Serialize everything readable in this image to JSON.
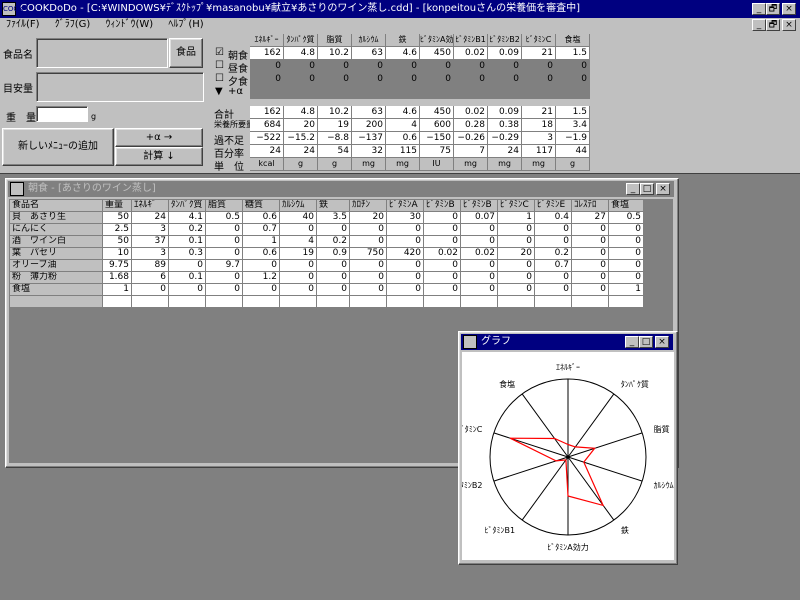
{
  "app": {
    "title": "COOKDoDo - [C:¥WINDOWS¥ﾃﾞｽｸﾄｯﾌﾟ¥masanobu¥献立¥あさりのワイン蒸し.cdd] - [konpeitouさんの栄養価を審査中]",
    "icon": "COOK",
    "controls": [
      "_",
      "🗗",
      "×"
    ]
  },
  "menu": [
    "ﾌｧｲﾙ(F)",
    "ｸﾞﾗﾌ(G)",
    "ｳｨﾝﾄﾞｳ(W)",
    "ﾍﾙﾌﾟ(H)"
  ],
  "menu_controls": [
    "_",
    "🗗",
    "×"
  ],
  "left": {
    "food_name_label": "食品名",
    "food_button": "食品",
    "measure_label": "目安量",
    "weight_label": "重　量",
    "weight_unit": "g",
    "add_menu_button": "新しいﾒﾆｭｰの追加",
    "plus_alpha_button": "+α →",
    "calc_button": "計算 ↓"
  },
  "summary": {
    "headers": [
      "ｴﾈﾙｷﾞｰ",
      "ﾀﾝﾊﾟｸ質",
      "脂質",
      "ｶﾙｼｳﾑ",
      "鉄",
      "ﾋﾞﾀﾐﾝA効力",
      "ﾋﾞﾀﾐﾝB1",
      "ﾋﾞﾀﾐﾝB2",
      "ﾋﾞﾀﾐﾝC",
      "食塩"
    ],
    "meals": [
      {
        "check": "☑",
        "label": "朝食",
        "values": [
          "162",
          "4.8",
          "10.2",
          "63",
          "4.6",
          "450",
          "0.02",
          "0.09",
          "21",
          "1.5"
        ],
        "gray": false
      },
      {
        "check": "☐",
        "label": "昼食",
        "values": [
          "0",
          "0",
          "0",
          "0",
          "0",
          "0",
          "0",
          "0",
          "0",
          "0"
        ],
        "gray": true
      },
      {
        "check": "☐",
        "label": "夕食",
        "values": [
          "0",
          "0",
          "0",
          "0",
          "0",
          "0",
          "0",
          "0",
          "0",
          "0"
        ],
        "gray": true
      },
      {
        "check": "▼",
        "label": "+α",
        "values": [
          "",
          "",
          "",
          "",
          "",
          "",
          "",
          "",
          "",
          ""
        ],
        "gray": true
      }
    ],
    "rows": [
      {
        "label": "合計",
        "values": [
          "162",
          "4.8",
          "10.2",
          "63",
          "4.6",
          "450",
          "0.02",
          "0.09",
          "21",
          "1.5"
        ]
      },
      {
        "label": "栄養所要量",
        "values": [
          "684",
          "20",
          "19",
          "200",
          "4",
          "600",
          "0.28",
          "0.38",
          "18",
          "3.4"
        ]
      },
      {
        "label": "過不足",
        "values": [
          "−522",
          "−15.2",
          "−8.8",
          "−137",
          "0.6",
          "−150",
          "−0.26",
          "−0.29",
          "3",
          "−1.9"
        ]
      },
      {
        "label": "百分率",
        "values": [
          "24",
          "24",
          "54",
          "32",
          "115",
          "75",
          "7",
          "24",
          "117",
          "44"
        ]
      },
      {
        "label": "単　位",
        "values": [
          "kcal",
          "g",
          "g",
          "mg",
          "mg",
          "IU",
          "mg",
          "mg",
          "mg",
          "g"
        ]
      }
    ]
  },
  "food_window": {
    "title": "朝食 - [あさりのワイン蒸し]",
    "controls": [
      "_",
      "□",
      "×"
    ],
    "headers": [
      "食品名",
      "重量",
      "ｴﾈﾙｷﾞ",
      "ﾀﾝﾊﾟｸ質",
      "脂質",
      "糖質",
      "ｶﾙｼｳﾑ",
      "鉄",
      "ｶﾛﾁﾝ",
      "ﾋﾞﾀﾐﾝA",
      "ﾋﾞﾀﾐﾝB",
      "ﾋﾞﾀﾐﾝB",
      "ﾋﾞﾀﾐﾝC",
      "ﾋﾞﾀﾐﾝE",
      "ｺﾚｽﾃﾛ",
      "食塩"
    ],
    "rows": [
      {
        "name": "貝　あさり生",
        "values": [
          "50",
          "24",
          "4.1",
          "0.5",
          "0.6",
          "40",
          "3.5",
          "20",
          "30",
          "0",
          "0.07",
          "1",
          "0.4",
          "27",
          "0.5"
        ]
      },
      {
        "name": "にんにく",
        "values": [
          "2.5",
          "3",
          "0.2",
          "0",
          "0.7",
          "0",
          "0",
          "0",
          "0",
          "0",
          "0",
          "0",
          "0",
          "0",
          "0"
        ]
      },
      {
        "name": "酒　ワイン白",
        "values": [
          "50",
          "37",
          "0.1",
          "0",
          "1",
          "4",
          "0.2",
          "0",
          "0",
          "0",
          "0",
          "0",
          "0",
          "0",
          "0"
        ]
      },
      {
        "name": "葉　パセリ",
        "values": [
          "10",
          "3",
          "0.3",
          "0",
          "0.6",
          "19",
          "0.9",
          "750",
          "420",
          "0.02",
          "0.02",
          "20",
          "0.2",
          "0",
          "0"
        ]
      },
      {
        "name": "オリーブ油",
        "values": [
          "9.75",
          "89",
          "0",
          "9.7",
          "0",
          "0",
          "0",
          "0",
          "0",
          "0",
          "0",
          "0",
          "0.7",
          "0",
          "0"
        ]
      },
      {
        "name": "粉　薄力粉",
        "values": [
          "1.68",
          "6",
          "0.1",
          "0",
          "1.2",
          "0",
          "0",
          "0",
          "0",
          "0",
          "0",
          "0",
          "0",
          "0",
          "0"
        ]
      },
      {
        "name": "食塩",
        "values": [
          "1",
          "0",
          "0",
          "0",
          "0",
          "0",
          "0",
          "0",
          "0",
          "0",
          "0",
          "0",
          "0",
          "0",
          "1"
        ]
      },
      {
        "name": "",
        "values": [
          "",
          "",
          "",
          "",
          "",
          "",
          "",
          "",
          "",
          "",
          "",
          "",
          "",
          "",
          ""
        ]
      }
    ]
  },
  "graph_window": {
    "title": "グラフ",
    "controls": [
      "_",
      "□",
      "×"
    ]
  },
  "chart_data": {
    "type": "radar",
    "axes": [
      "ｴﾈﾙｷﾞｰ",
      "ﾀﾝﾊﾟｸ質",
      "脂質",
      "ｶﾙｼｳﾑ",
      "鉄",
      "ﾋﾞﾀﾐﾝA効力",
      "ﾋﾞﾀﾐﾝB1",
      "ﾋﾞﾀﾐﾝB2",
      "ﾋﾞﾀﾐﾝC",
      "食塩"
    ],
    "values": [
      24,
      24,
      54,
      32,
      115,
      75,
      7,
      24,
      117,
      44
    ],
    "max": 150,
    "color": "#ff0000"
  }
}
